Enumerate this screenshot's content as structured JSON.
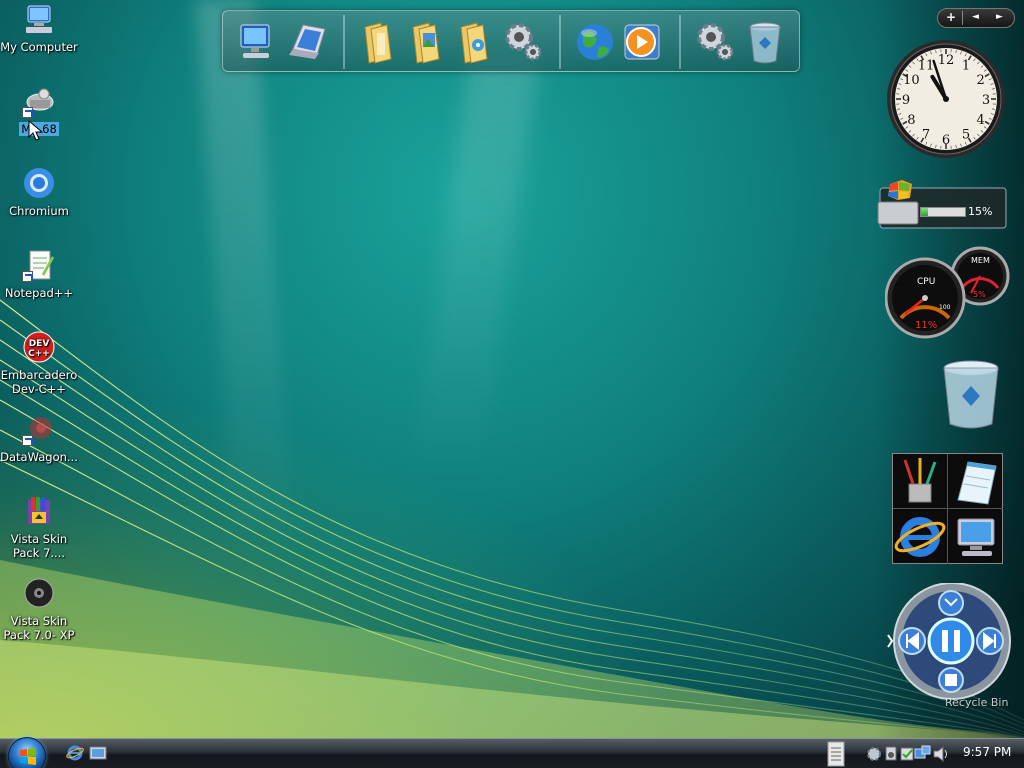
{
  "desktop": {
    "icons": [
      {
        "label": "My Computer",
        "icon": "my-computer-icon"
      },
      {
        "label": "M...68",
        "icon": "network-drive-icon",
        "selected": true
      },
      {
        "label": "Chromium",
        "icon": "chromium-icon"
      },
      {
        "label": "Notepad++",
        "icon": "notepad-plus-plus-icon"
      },
      {
        "label": "Embarcadero Dev-C++",
        "icon": "dev-cpp-icon"
      },
      {
        "label": "DataWagon...",
        "icon": "datawagon-icon"
      },
      {
        "label": "Vista Skin Pack 7....",
        "icon": "installer-icon"
      },
      {
        "label": "Vista Skin Pack 7.0- XP",
        "icon": "media-disc-icon"
      }
    ]
  },
  "dock": {
    "items": [
      "computer-icon",
      "display-settings-icon",
      "documents-folder-icon",
      "pictures-folder-icon",
      "music-folder-icon",
      "settings-gear-icon",
      "globe-icon",
      "media-player-icon",
      "system-gear-icon",
      "recycle-bin-icon"
    ]
  },
  "sidebar": {
    "controls": {
      "add": "+",
      "prev": "◄",
      "next": "►"
    },
    "clock": {
      "hour": 10,
      "minute": 57,
      "numbers": [
        "12",
        "1",
        "2",
        "3",
        "4",
        "5",
        "6",
        "7",
        "8",
        "9",
        "10",
        "11"
      ]
    },
    "progress": {
      "percent": 15,
      "text": "15%"
    },
    "meter": {
      "cpu_label": "CPU",
      "cpu_value": "11%",
      "cpu_max": "100",
      "mem_label": "MEM",
      "mem_value": "5%"
    },
    "media_caption": "Recycle Bin"
  },
  "taskbar": {
    "time": "9:57 PM"
  },
  "colors": {
    "selection": "#4fa7e0",
    "accent": "#2f7fd0",
    "wallpaper": "#0f7f7c"
  }
}
